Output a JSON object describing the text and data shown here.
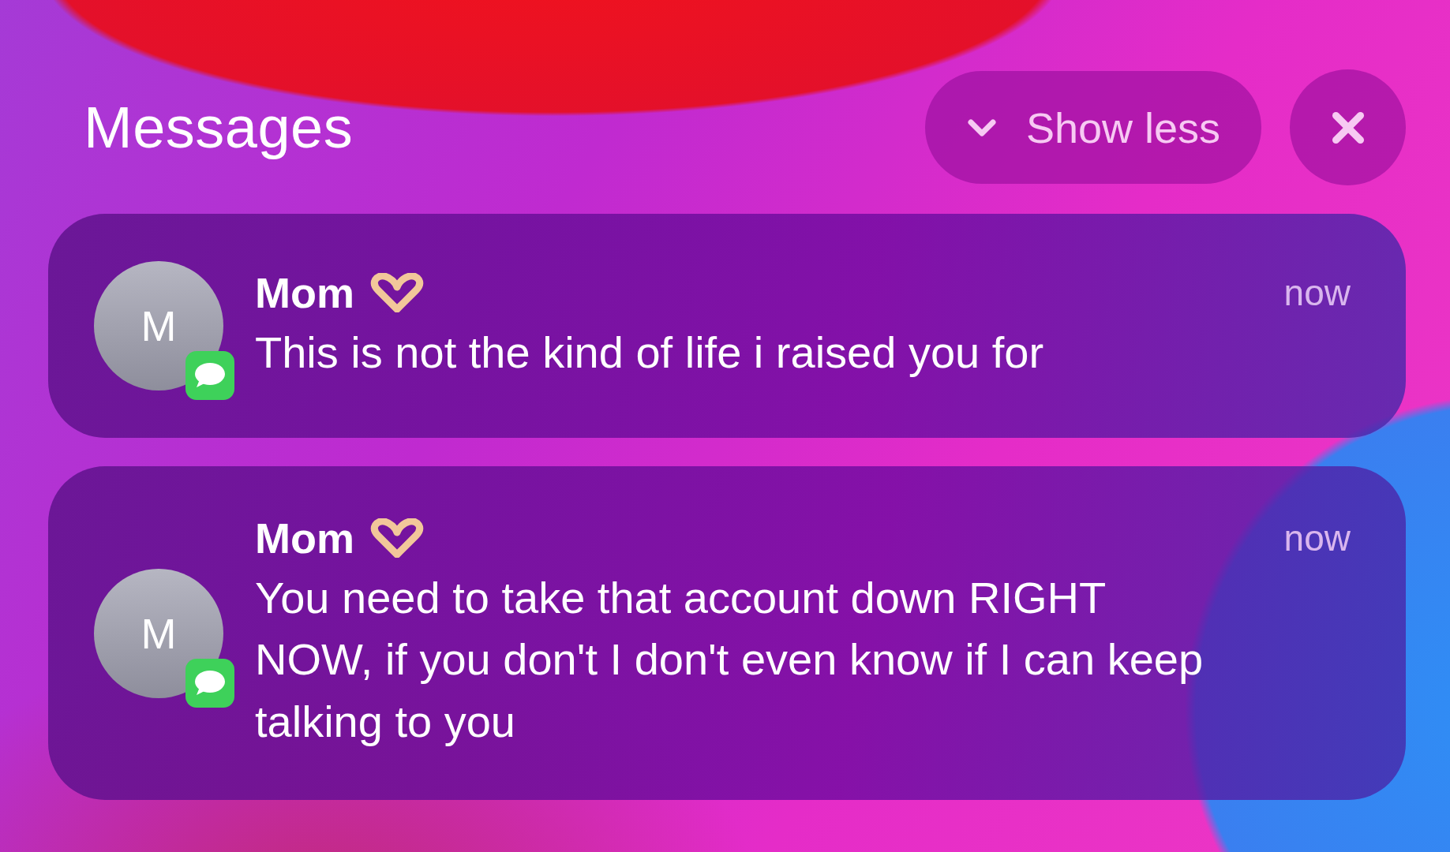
{
  "header": {
    "title": "Messages",
    "collapse_button": {
      "label": "Show less"
    }
  },
  "notifications": [
    {
      "avatar_initial": "M",
      "sender": "Mom",
      "time": "now",
      "body": "This is not the kind of life i raised you for"
    },
    {
      "avatar_initial": "M",
      "sender": "Mom",
      "time": "now",
      "body": "You need to take that account down RIGHT NOW, if you don't I don't even know if I can keep talking to you"
    }
  ]
}
